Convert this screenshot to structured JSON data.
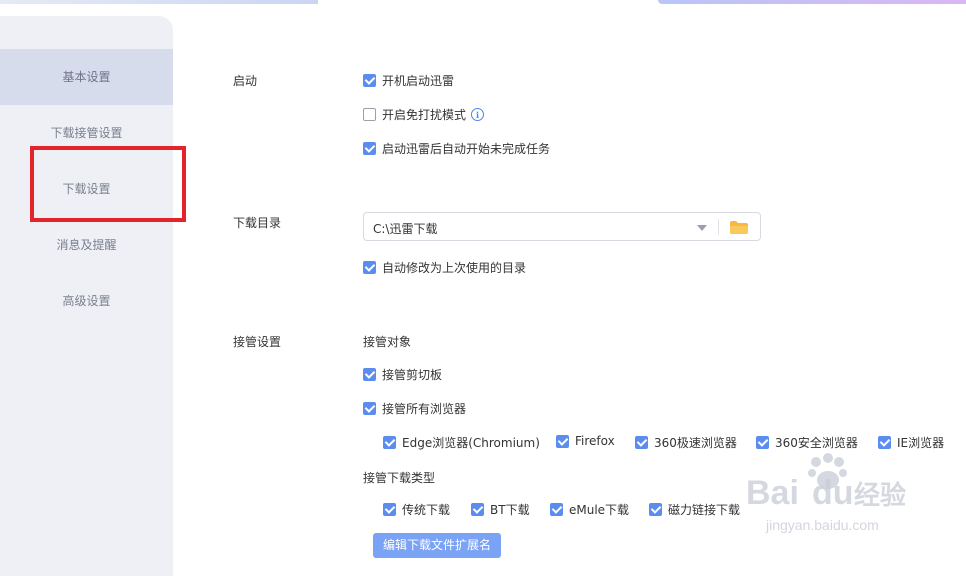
{
  "sidebar": {
    "items": [
      {
        "label": "基本设置",
        "active": true
      },
      {
        "label": "下载接管设置",
        "active": false
      },
      {
        "label": "下载设置",
        "active": false
      },
      {
        "label": "消息及提醒",
        "active": false
      },
      {
        "label": "高级设置",
        "active": false
      }
    ]
  },
  "startup": {
    "label": "启动",
    "options": [
      {
        "label": "开机启动迅雷",
        "checked": true
      },
      {
        "label": "开启免打扰模式",
        "checked": false,
        "info_icon": "info-icon"
      },
      {
        "label": "启动迅雷后自动开始未完成任务",
        "checked": true
      }
    ]
  },
  "download_dir": {
    "label": "下载目录",
    "path": "C:\\迅雷下载",
    "folder_icon": "folder-icon",
    "auto_change": {
      "label": "自动修改为上次使用的目录",
      "checked": true
    }
  },
  "takeover": {
    "label": "接管设置",
    "target_label": "接管对象",
    "clipboard": {
      "label": "接管剪切板",
      "checked": true
    },
    "all_browsers": {
      "label": "接管所有浏览器",
      "checked": true
    },
    "browsers": [
      {
        "label": "Edge浏览器(Chromium)",
        "checked": true
      },
      {
        "label": "Firefox",
        "checked": true
      },
      {
        "label": "360极速浏览器",
        "checked": true
      },
      {
        "label": "360安全浏览器",
        "checked": true
      },
      {
        "label": "IE浏览器",
        "checked": true
      }
    ],
    "types_label": "接管下载类型",
    "types": [
      {
        "label": "传统下载",
        "checked": true
      },
      {
        "label": "BT下载",
        "checked": true
      },
      {
        "label": "eMule下载",
        "checked": true
      },
      {
        "label": "磁力链接下载",
        "checked": true
      }
    ],
    "edit_ext_button": "编辑下载文件扩展名"
  },
  "watermark": {
    "brand": "Bai",
    "brand2": "du",
    "brand3": "经验",
    "url": "jingyan.baidu.com"
  },
  "colors": {
    "accent": "#5b8def",
    "annotation": "#e3242b",
    "sidebar_bg": "#eef0f6",
    "sidebar_active": "#d7dced"
  }
}
